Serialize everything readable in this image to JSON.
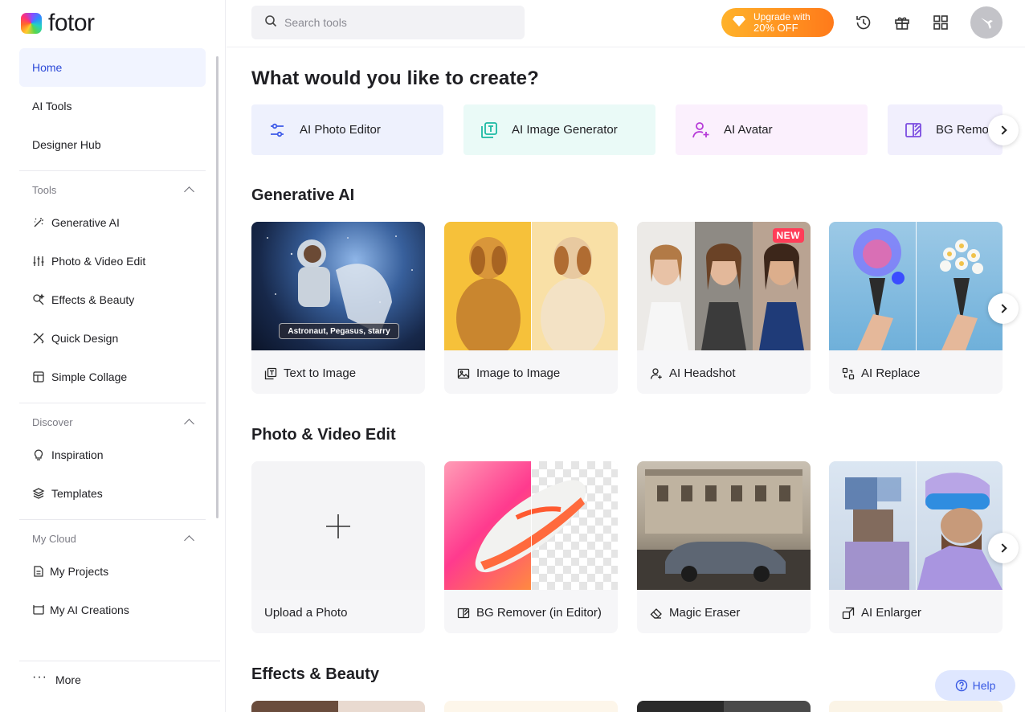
{
  "brand": {
    "name": "fotor"
  },
  "sidebar": {
    "top_items": [
      {
        "label": "Home",
        "active": true
      },
      {
        "label": "AI Tools"
      },
      {
        "label": "Designer Hub"
      }
    ],
    "tools_section": {
      "title": "Tools",
      "items": [
        {
          "label": "Generative AI",
          "icon": "magic-wand-icon"
        },
        {
          "label": "Photo & Video Edit",
          "icon": "sliders-icon"
        },
        {
          "label": "Effects & Beauty",
          "icon": "sparkle-icon"
        },
        {
          "label": "Quick Design",
          "icon": "design-tools-icon"
        },
        {
          "label": "Simple Collage",
          "icon": "collage-icon"
        }
      ]
    },
    "discover_section": {
      "title": "Discover",
      "items": [
        {
          "label": "Inspiration",
          "icon": "bulb-icon"
        },
        {
          "label": "Templates",
          "icon": "layers-icon"
        }
      ]
    },
    "cloud_section": {
      "title": "My Cloud",
      "items": [
        {
          "label": "My Projects",
          "icon": "document-icon"
        },
        {
          "label": "My AI Creations",
          "icon": "creations-icon"
        }
      ]
    },
    "more_label": "More"
  },
  "header": {
    "search_placeholder": "Search tools",
    "upgrade_line1": "Upgrade with",
    "upgrade_line2": "20% OFF"
  },
  "main": {
    "title": "What would you like to create?",
    "quick_actions": [
      {
        "label": "AI Photo Editor",
        "bg": "#eef1fd"
      },
      {
        "label": "AI Image Generator",
        "bg": "#eafaf7"
      },
      {
        "label": "AI Avatar",
        "bg": "#fbf0fd"
      },
      {
        "label": "BG Remover",
        "bg": "#f1effd"
      }
    ],
    "generative_ai": {
      "title": "Generative AI",
      "prompt_tag": "Astronaut, Pegasus, starry",
      "cards": [
        {
          "label": "Text to Image"
        },
        {
          "label": "Image to Image"
        },
        {
          "label": "AI Headshot",
          "badge": "NEW"
        },
        {
          "label": "AI Replace"
        }
      ]
    },
    "photo_video_edit": {
      "title": "Photo & Video Edit",
      "cards": [
        {
          "label": "Upload a Photo"
        },
        {
          "label": "BG Remover (in Editor)"
        },
        {
          "label": "Magic Eraser"
        },
        {
          "label": "AI Enlarger"
        }
      ]
    },
    "effects_beauty": {
      "title": "Effects & Beauty"
    }
  },
  "help_label": "Help",
  "colors": {
    "accent": "#2d4ad8",
    "upgrade": "#ff8a1f",
    "new_badge": "#ff3d58"
  }
}
